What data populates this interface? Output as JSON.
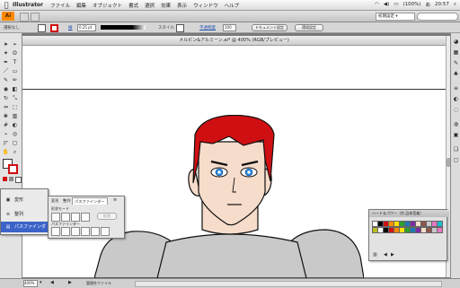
{
  "menubar": {
    "app_name": "Illustrator",
    "items": [
      "ファイル",
      "編集",
      "オブジェクト",
      "書式",
      "選択",
      "効果",
      "表示",
      "ウィンドウ",
      "ヘルプ"
    ],
    "battery": "(100%)",
    "input_method": "あ",
    "clock": "20:57"
  },
  "appbar": {
    "logo": "Ai",
    "workspace": "初期設定 ▾"
  },
  "control": {
    "selection_label": "選択なし",
    "stroke_label": "線",
    "stroke_weight": "0.25 pt",
    "style_label": "スタイル",
    "opacity_label": "不透明度",
    "opacity_value": "100",
    "doc_setup_button": "ドキュメント設定",
    "prefs_button": "環境設定"
  },
  "document": {
    "title": "メルビン&アルミーン.ai* @ 400% (RGB/プレビュー)"
  },
  "status": {
    "zoom": "400%",
    "info": "管理外ファイル"
  },
  "popup": {
    "items": [
      {
        "icon": "▣",
        "label": "変形"
      },
      {
        "icon": "≡",
        "label": "整列"
      },
      {
        "icon": "▤",
        "label": "パスファインダー"
      }
    ]
  },
  "pathfinder": {
    "tabs": [
      "変形",
      "整列",
      "パスファインダー"
    ],
    "shape_modes_label": "形状モード",
    "pathfinders_label": "パスファインダー",
    "expand_button": "拡張"
  },
  "swatches": {
    "title": "ハード＆パワー（作 品体音楽）"
  },
  "colors": {
    "hair": "#d00f12",
    "skin": "#f6dcca",
    "eyes": "#2c8ce0",
    "armor": "#c9c9c9",
    "accent_orange": "#ff8a00",
    "menu_select": "#3b63c8"
  }
}
